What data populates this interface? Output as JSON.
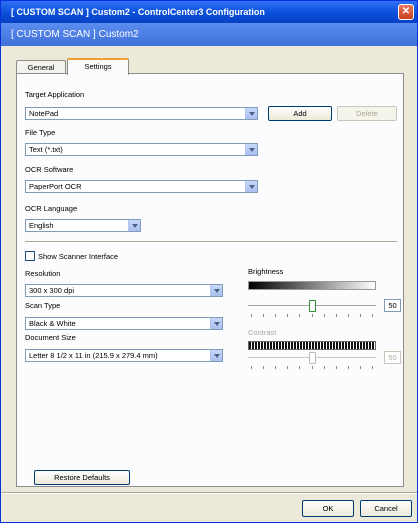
{
  "window": {
    "title": "[ CUSTOM SCAN ]  Custom2 - ControlCenter3 Configuration",
    "close_glyph": "✕"
  },
  "banner": {
    "text": "[ CUSTOM SCAN ]   Custom2"
  },
  "tabs": [
    {
      "label": "General"
    },
    {
      "label": "Settings",
      "active": true
    }
  ],
  "target_application": {
    "label": "Target Application",
    "value": "NotePad",
    "add_label": "Add",
    "delete_label": "Delete"
  },
  "file_type": {
    "label": "File Type",
    "value": "Text (*.txt)"
  },
  "ocr_software": {
    "label": "OCR Software",
    "value": "PaperPort OCR"
  },
  "ocr_language": {
    "label": "OCR Language",
    "value": "English"
  },
  "scanner_interface": {
    "label": "Show Scanner Interface",
    "checked": false
  },
  "resolution": {
    "label": "Resolution",
    "value": "300 x 300 dpi"
  },
  "scan_type": {
    "label": "Scan Type",
    "value": "Black & White"
  },
  "document_size": {
    "label": "Document Size",
    "value": "Letter 8 1/2 x 11 in (215.9 x 279.4 mm)"
  },
  "brightness": {
    "label": "Brightness",
    "value": "50",
    "level": 0.5
  },
  "contrast": {
    "label": "Contrast",
    "value": "50",
    "level": 0.5,
    "enabled": false
  },
  "restore_defaults_label": "Restore Defaults",
  "ok_label": "OK",
  "cancel_label": "Cancel",
  "colors": {
    "titlebar": "#0a4fd9",
    "banner": "#3d70d8",
    "dialog_bg": "#ece9d8",
    "slider_thumb": "#2a8f2a"
  }
}
